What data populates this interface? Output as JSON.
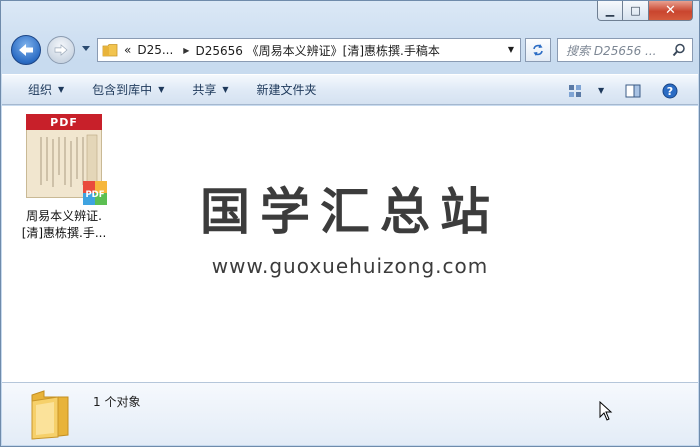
{
  "window": {
    "controls": {
      "minimize": "▁",
      "maximize": "□",
      "close": "✕"
    }
  },
  "nav": {
    "address": {
      "overflow": "«",
      "crumbs": [
        "D25...",
        "D25656 《周易本义辨证》[清]惠栋撰.手稿本"
      ]
    },
    "search_placeholder": "搜索 D25656 ..."
  },
  "toolbar": {
    "items": [
      {
        "label": "组织",
        "dropdown": true
      },
      {
        "label": "包含到库中",
        "dropdown": true
      },
      {
        "label": "共享",
        "dropdown": true
      },
      {
        "label": "新建文件夹",
        "dropdown": false
      }
    ]
  },
  "files": [
    {
      "name": "周易本义辨证.[清]惠栋撰.手...",
      "thumb_banner": "PDF",
      "badge": "PDF"
    }
  ],
  "watermark": {
    "title": "国学汇总站",
    "url": "www.guoxuehuizong.com"
  },
  "details": {
    "count": "1 个对象"
  },
  "colors": {
    "accent": "#2b6cc4",
    "pdf_red": "#c8202a",
    "folder": "#f2c44f"
  }
}
